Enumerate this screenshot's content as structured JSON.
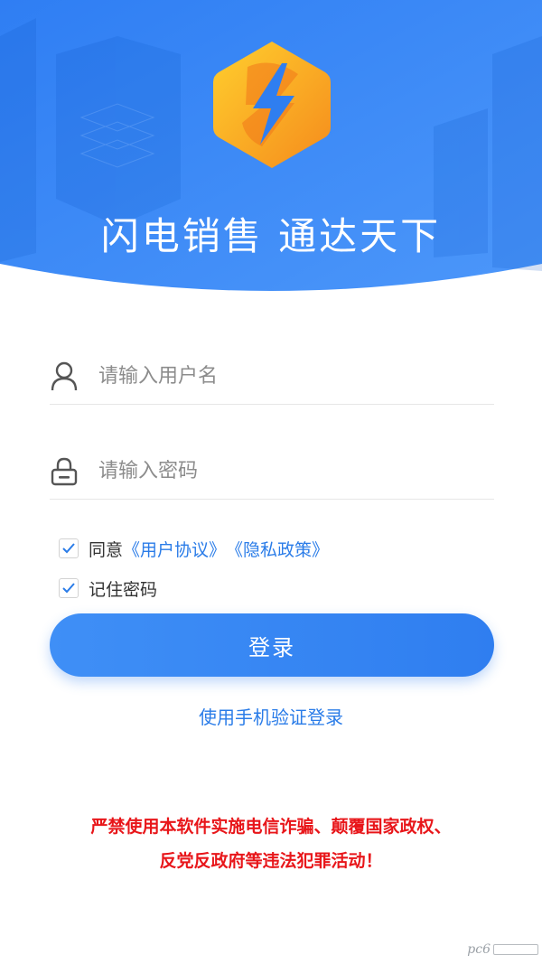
{
  "header": {
    "slogan_part1": "闪电销售",
    "slogan_part2": "通达天下"
  },
  "form": {
    "username_placeholder": "请输入用户名",
    "password_placeholder": "请输入密码",
    "agree_prefix": "同意",
    "user_agreement_link": "《用户协议》",
    "privacy_policy_link": "《隐私政策》",
    "remember_password": "记住密码",
    "agree_checked": true,
    "remember_checked": true
  },
  "actions": {
    "login_button": "登录",
    "phone_login_link": "使用手机验证登录"
  },
  "notice": {
    "line1": "严禁使用本软件实施电信诈骗、颠覆国家政权、",
    "line2": "反党反政府等违法犯罪活动！"
  },
  "watermark": {
    "text": "pc6"
  },
  "colors": {
    "primary": "#2f7ef0",
    "link": "#2a7ce8",
    "warning": "#e8161a",
    "logo_orange": "#f7a21b"
  },
  "icons": {
    "logo": "lightning-hexagon-icon",
    "username": "user-icon",
    "password": "lock-icon",
    "checkbox": "check-icon"
  }
}
